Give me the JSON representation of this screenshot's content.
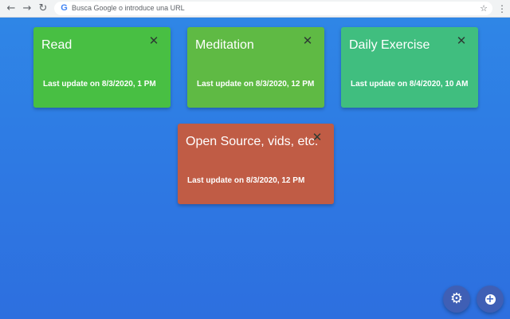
{
  "browser": {
    "back_icon": "arrow-left-icon",
    "forward_icon": "arrow-right-icon",
    "reload_icon": "reload-icon",
    "omnibox_placeholder": "Busca Google o introduce una URL",
    "google_logo": "G",
    "bookmark_icon": "star-icon",
    "menu_icon": "kebab-menu-icon"
  },
  "cards": [
    {
      "title": "Read",
      "last_update": "Last update on 8/3/2020, 1 PM",
      "color": "#48bf43"
    },
    {
      "title": "Meditation",
      "last_update": "Last update on 8/3/2020, 12 PM",
      "color": "#5fba44"
    },
    {
      "title": "Daily Exercise",
      "last_update": "Last update on 8/4/2020, 10 AM",
      "color": "#40be7f"
    },
    {
      "title": "Open Source, vids, etc.",
      "last_update": "Last update on 8/3/2020, 12 PM",
      "color": "#c05c45"
    }
  ],
  "colors": {
    "background": "#2e79e3",
    "fab": "#3f5fb5"
  },
  "fabs": {
    "settings_icon": "gear-icon",
    "add_icon": "plus-circle-icon"
  }
}
